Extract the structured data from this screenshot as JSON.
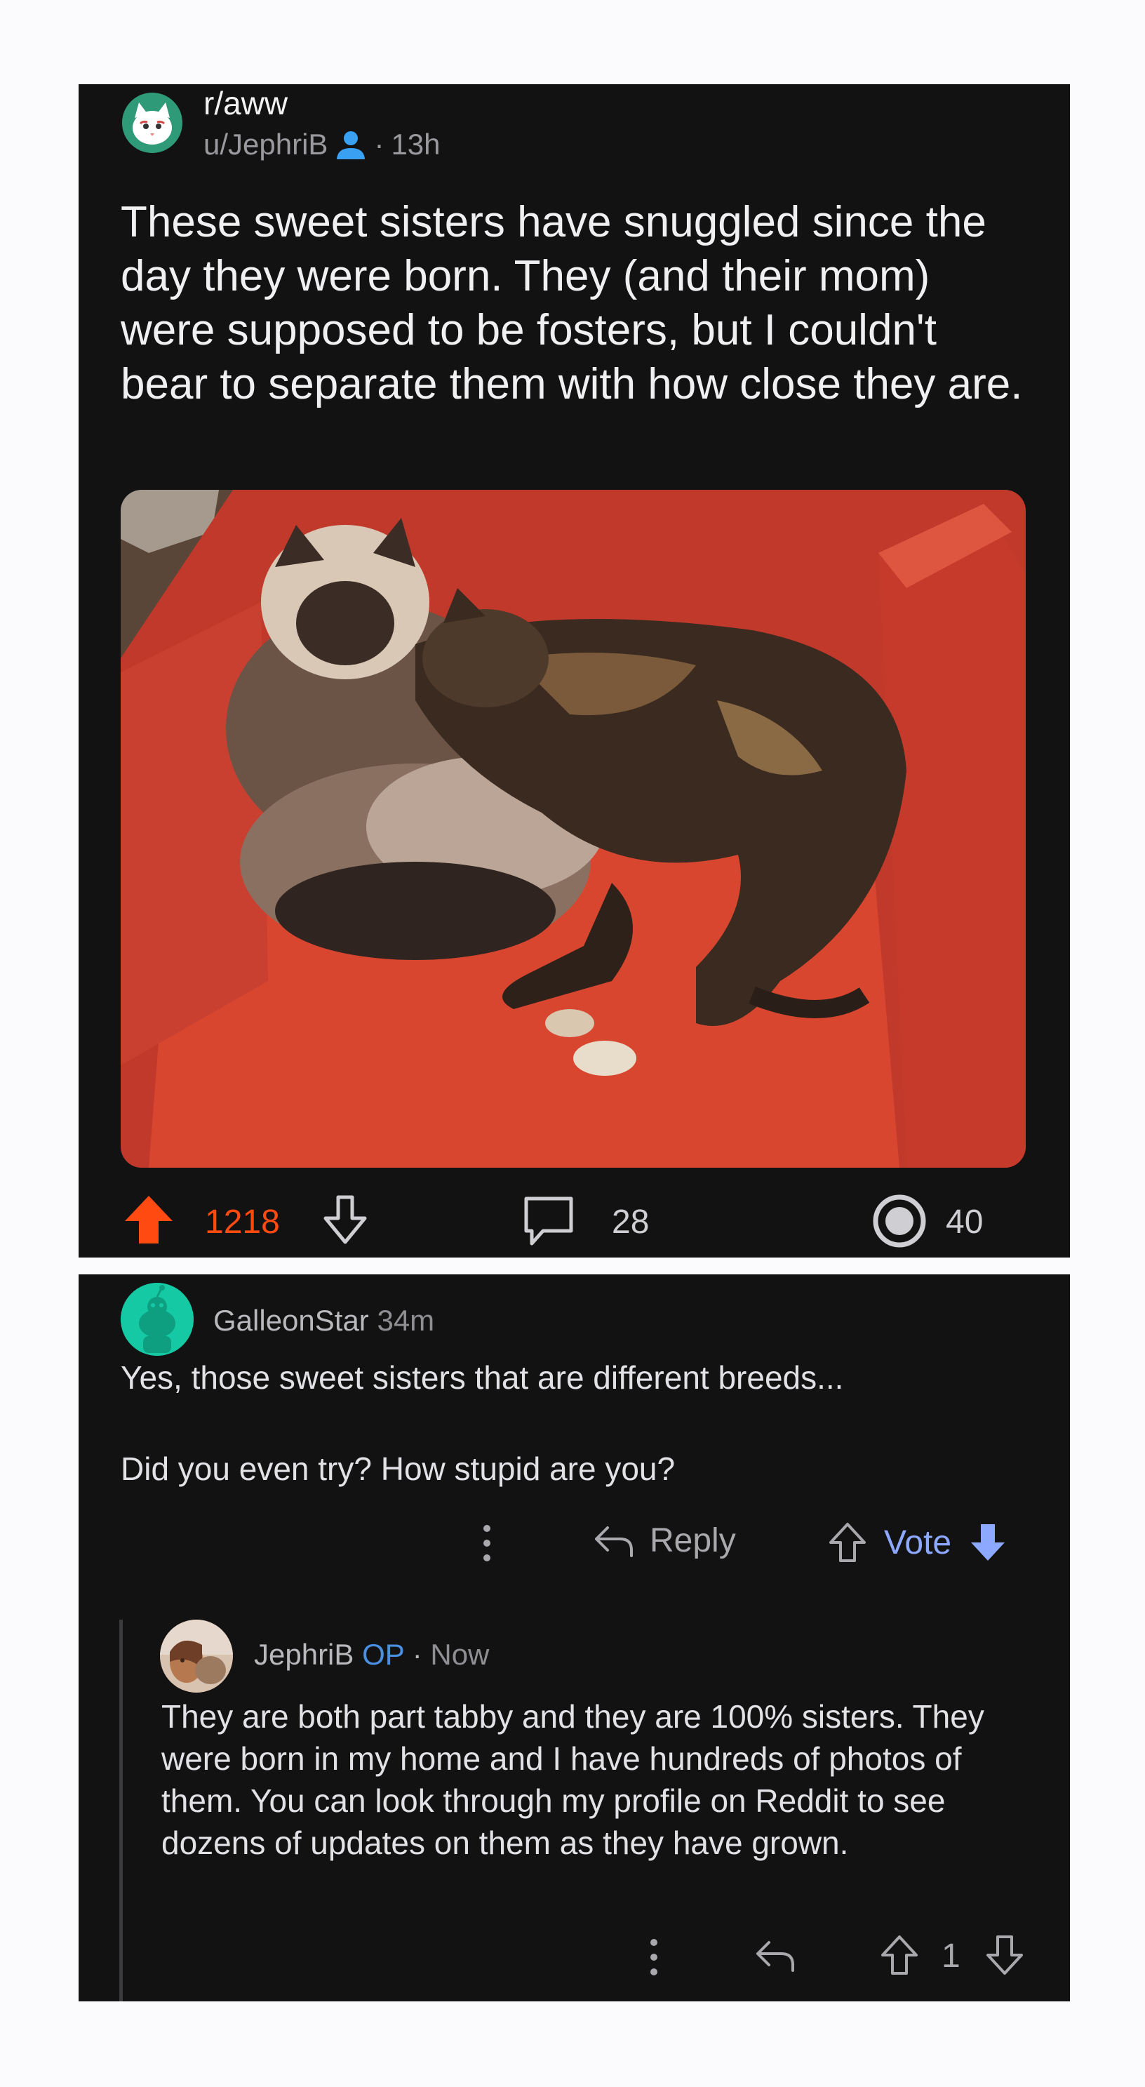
{
  "post": {
    "subreddit": "r/aww",
    "author": "u/JephriB",
    "time": "13h",
    "separator": "·",
    "title": "These sweet sisters have snuggled since the day they were born. They (and their mom) were supposed to be fosters, but I couldn't bear to separate them with how close they are.",
    "image_description": "Two cats snuggling on a red armchair",
    "score": "1218",
    "comments": "28",
    "awards": "40",
    "colors": {
      "upvote_active": "#ff4a12",
      "background": "#121213"
    }
  },
  "comment1": {
    "author": "GalleonStar",
    "time": "34m",
    "body_line1": "Yes, those sweet sisters that are different breeds...",
    "body_line2": "Did you even try? How stupid are you?",
    "reply_label": "Reply",
    "vote_label": "Vote",
    "colors": {
      "vote": "#8da8ff"
    }
  },
  "comment2": {
    "author": "JephriB",
    "op_badge": "OP",
    "time": "Now",
    "separator": "·",
    "body": "They are both part tabby and they are 100% sisters. They were born in my home and I have hundreds of photos of them. You can look through my profile on Reddit to see dozens of updates on them as they have grown.",
    "score": "1"
  }
}
